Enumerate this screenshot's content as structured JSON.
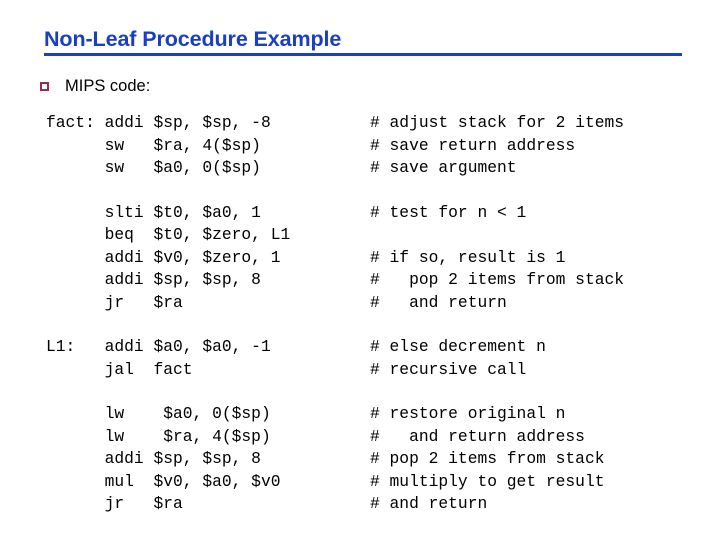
{
  "slide": {
    "title": "Non-Leaf Procedure Example",
    "title_color": "#1A3FC4",
    "bullet_color": "#9E2B4C",
    "bullet_icon": "hollow-square-bullet",
    "bullet_text": "MIPS code:"
  },
  "code": {
    "blocks": [
      {
        "lines": [
          {
            "code": "fact: addi $sp, $sp, -8",
            "comment": "# adjust stack for 2 items"
          },
          {
            "code": "      sw   $ra, 4($sp)",
            "comment": "# save return address"
          },
          {
            "code": "      sw   $a0, 0($sp)",
            "comment": "# save argument"
          }
        ]
      },
      {
        "lines": [
          {
            "code": "      slti $t0, $a0, 1",
            "comment": "# test for n < 1"
          },
          {
            "code": "      beq  $t0, $zero, L1",
            "comment": ""
          },
          {
            "code": "      addi $v0, $zero, 1",
            "comment": "# if so, result is 1"
          },
          {
            "code": "      addi $sp, $sp, 8",
            "comment": "#   pop 2 items from stack"
          },
          {
            "code": "      jr   $ra",
            "comment": "#   and return"
          }
        ]
      },
      {
        "lines": [
          {
            "code": "L1:   addi $a0, $a0, -1",
            "comment": "# else decrement n"
          },
          {
            "code": "      jal  fact",
            "comment": "# recursive call"
          }
        ]
      },
      {
        "lines": [
          {
            "code": "      lw    $a0, 0($sp)",
            "comment": "# restore original n"
          },
          {
            "code": "      lw    $ra, 4($sp)",
            "comment": "#   and return address"
          },
          {
            "code": "      addi $sp, $sp, 8",
            "comment": "# pop 2 items from stack"
          },
          {
            "code": "      mul  $v0, $a0, $v0",
            "comment": "# multiply to get result"
          },
          {
            "code": "      jr   $ra",
            "comment": "# and return"
          }
        ]
      }
    ]
  }
}
